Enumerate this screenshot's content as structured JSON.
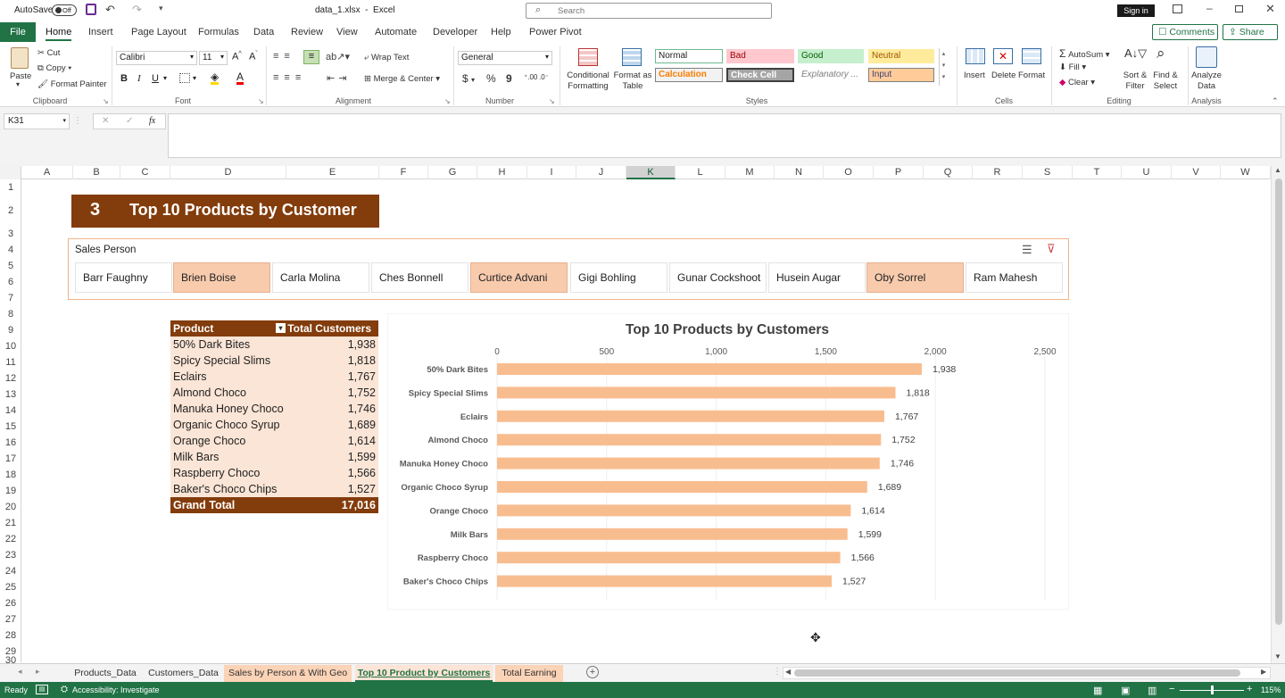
{
  "titlebar": {
    "autosave_label": "AutoSave",
    "autosave_state": "Off",
    "filename": "data_1.xlsx",
    "app": "Excel",
    "search_placeholder": "Search",
    "signin_label": "Sign in"
  },
  "ribbon_tabs": [
    "File",
    "Home",
    "Insert",
    "Page Layout",
    "Formulas",
    "Data",
    "Review",
    "View",
    "Automate",
    "Developer",
    "Help",
    "Power Pivot"
  ],
  "ribbon_right": {
    "comments_label": "Comments",
    "share_label": "Share"
  },
  "clipboard": {
    "paste": "Paste",
    "cut": "Cut",
    "copy": "Copy",
    "format_painter": "Format Painter",
    "group": "Clipboard"
  },
  "font": {
    "name": "Calibri",
    "size": "11",
    "group": "Font"
  },
  "alignment": {
    "wrap_text": "Wrap Text",
    "merge_center": "Merge & Center",
    "group": "Alignment"
  },
  "number": {
    "format": "General",
    "group": "Number"
  },
  "styles": {
    "conditional": "Conditional Formatting",
    "format_table": "Format as Table",
    "normal": "Normal",
    "bad": "Bad",
    "good": "Good",
    "neutral": "Neutral",
    "calculation": "Calculation",
    "check_cell": "Check Cell",
    "explanatory": "Explanatory ...",
    "input": "Input",
    "group": "Styles"
  },
  "cells": {
    "insert": "Insert",
    "delete": "Delete",
    "format": "Format",
    "group": "Cells"
  },
  "editing": {
    "autosum": "AutoSum",
    "fill": "Fill",
    "clear": "Clear",
    "sort_filter": "Sort & Filter",
    "find_select": "Find & Select",
    "group": "Editing"
  },
  "analysis": {
    "analyze": "Analyze Data",
    "group": "Analysis"
  },
  "formula_bar": {
    "name_box": "K31",
    "fx": "fx",
    "value": ""
  },
  "columns": [
    "A",
    "B",
    "C",
    "D",
    "E",
    "F",
    "G",
    "H",
    "I",
    "J",
    "K",
    "L",
    "M",
    "N",
    "O",
    "P",
    "Q",
    "R",
    "S",
    "T",
    "U",
    "V",
    "W"
  ],
  "rows": [
    "1",
    "2",
    "3",
    "4",
    "5",
    "6",
    "7",
    "8",
    "9",
    "10",
    "11",
    "12",
    "13",
    "14",
    "15",
    "16",
    "17",
    "18",
    "19",
    "20",
    "21",
    "22",
    "23",
    "24",
    "25",
    "26",
    "27",
    "28",
    "29",
    "30"
  ],
  "banner": {
    "number": "3",
    "title": "Top 10 Products by Customer",
    "color": "#833C0B"
  },
  "slicer": {
    "title": "Sales Person",
    "items": [
      {
        "label": "Barr Faughny",
        "selected": false
      },
      {
        "label": "Brien Boise",
        "selected": true
      },
      {
        "label": "Carla Molina",
        "selected": false
      },
      {
        "label": "Ches Bonnell",
        "selected": false
      },
      {
        "label": "Curtice Advani",
        "selected": true
      },
      {
        "label": "Gigi Bohling",
        "selected": false
      },
      {
        "label": "Gunar Cockshoot",
        "selected": false
      },
      {
        "label": "Husein Augar",
        "selected": false
      },
      {
        "label": "Oby Sorrel",
        "selected": true
      },
      {
        "label": "Ram Mahesh",
        "selected": false
      }
    ]
  },
  "pivot": {
    "header_product": "Product",
    "header_total": "Total Customers",
    "rows": [
      {
        "product": "50% Dark Bites",
        "total": "1,938"
      },
      {
        "product": "Spicy Special Slims",
        "total": "1,818"
      },
      {
        "product": "Eclairs",
        "total": "1,767"
      },
      {
        "product": "Almond Choco",
        "total": "1,752"
      },
      {
        "product": "Manuka Honey Choco",
        "total": "1,746"
      },
      {
        "product": "Organic Choco Syrup",
        "total": "1,689"
      },
      {
        "product": "Orange Choco",
        "total": "1,614"
      },
      {
        "product": "Milk Bars",
        "total": "1,599"
      },
      {
        "product": "Raspberry Choco",
        "total": "1,566"
      },
      {
        "product": "Baker's Choco Chips",
        "total": "1,527"
      }
    ],
    "grand_total_label": "Grand Total",
    "grand_total": "17,016"
  },
  "chart_data": {
    "type": "bar",
    "title": "Top 10 Products by Customers",
    "categories": [
      "50% Dark Bites",
      "Spicy Special Slims",
      "Eclairs",
      "Almond Choco",
      "Manuka Honey Choco",
      "Organic Choco Syrup",
      "Orange Choco",
      "Milk Bars",
      "Raspberry Choco",
      "Baker's Choco Chips"
    ],
    "values": [
      1938,
      1818,
      1767,
      1752,
      1746,
      1689,
      1614,
      1599,
      1566,
      1527
    ],
    "value_labels": [
      "1,938",
      "1,818",
      "1,767",
      "1,752",
      "1,746",
      "1,689",
      "1,614",
      "1,599",
      "1,566",
      "1,527"
    ],
    "xlim": [
      0,
      2500
    ],
    "ticks": [
      "0",
      "500",
      "1,000",
      "1,500",
      "2,000",
      "2,500"
    ],
    "bar_color": "#F8BD8F",
    "orientation": "horizontal",
    "axis_position": "top",
    "grid": true
  },
  "sheet_tabs": [
    {
      "label": "Products_Data",
      "active": false,
      "colored": false
    },
    {
      "label": "Customers_Data",
      "active": false,
      "colored": false
    },
    {
      "label": "Sales by Person & With Geo",
      "active": false,
      "colored": true
    },
    {
      "label": "Top 10 Product by Customers",
      "active": true,
      "colored": true
    },
    {
      "label": "Total Earning",
      "active": false,
      "colored": true
    }
  ],
  "status": {
    "ready": "Ready",
    "accessibility": "Accessibility: Investigate",
    "zoom": "115%"
  },
  "colors": {
    "excel_green": "#217346",
    "dark_brown": "#833C0B",
    "peach": "#F8CBAD",
    "light_peach": "#FBE5D6"
  }
}
